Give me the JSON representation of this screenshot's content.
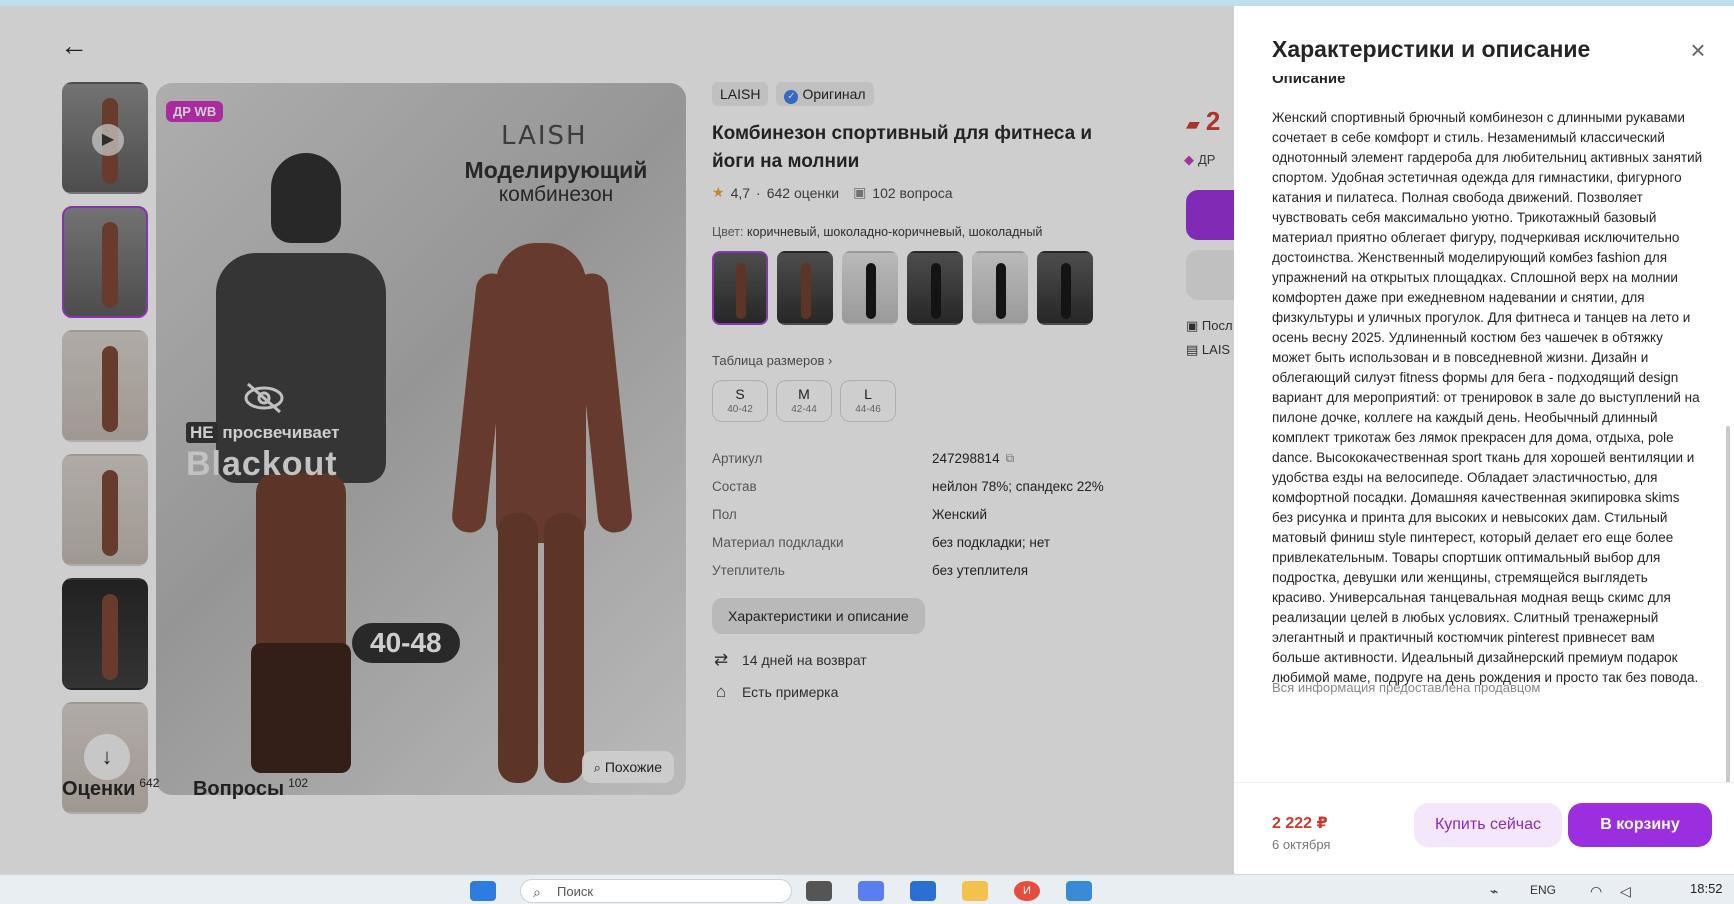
{
  "page": {
    "back_label": "←",
    "thumb_scroll_label": "↓",
    "play_label": "▶"
  },
  "photo": {
    "promo_badge": "ДР WB",
    "brand": "LAISH",
    "headline": "Моделирующий",
    "subheadline": "комбинезон",
    "ne_tag": "НЕ",
    "ne_rest": "просвечивает",
    "blackout": "Blackout",
    "size_range": "40-48",
    "similar_label": "Похожие"
  },
  "product": {
    "brand_badge": "LAISH",
    "original_badge": "Оригинал",
    "title": "Комбинезон спортивный для фитнеса и йоги на молнии",
    "rating": "4,7",
    "ratings_count": "642 оценки",
    "questions_count": "102 вопроса",
    "color_label": "Цвет:",
    "color_value": "коричневый, шоколадно-коричневый, шоколадный",
    "size_table_link": "Таблица размеров",
    "sizes": [
      {
        "size": "S",
        "range": "40-42"
      },
      {
        "size": "M",
        "range": "42-44"
      },
      {
        "size": "L",
        "range": "44-46"
      }
    ],
    "params": [
      {
        "key": "Артикул",
        "value": "247298814"
      },
      {
        "key": "Состав",
        "value": "нейлон 78%; спандекс 22%"
      },
      {
        "key": "Пол",
        "value": "Женский"
      },
      {
        "key": "Материал подкладки",
        "value": "без подкладки; нет"
      },
      {
        "key": "Утеплитель",
        "value": "без утеплителя"
      }
    ],
    "desc_button": "Характеристики и описание",
    "features": [
      {
        "icon": "return-icon",
        "text": "14 дней на возврат"
      },
      {
        "icon": "hanger-icon",
        "text": "Есть примерка"
      }
    ]
  },
  "price_card": {
    "price_partial": "2",
    "tag_partial": "ДР",
    "line1_partial": "Посл",
    "line2_partial": "LAIS"
  },
  "tabs": [
    {
      "label": "Оценки",
      "count": "642"
    },
    {
      "label": "Вопросы",
      "count": "102"
    }
  ],
  "drawer": {
    "title": "Характеристики и описание",
    "section_heading": "Описание",
    "description": "Женский спортивный брючный комбинезон с длинными рукавами сочетает в себе комфорт и стиль. Незаменимый классический однотонный элемент гардероба для любительниц активных занятий спортом. Удобная эстетичная одежда для гимнастики, фигурного катания и пилатеса. Полная свобода движений. Позволяет чувствовать себя максимально уютно. Трикотажный базовый материал приятно облегает фигуру, подчеркивая исключительно достоинства. Женственный моделирующий комбез fashion для упражнений на открытых площадках. Сплошной верх на молнии комфортен даже при ежедневном надевании и снятии, для физкультуры и уличных прогулок. Для фитнеса и танцев на лето и осень весну 2025. Удлиненный костюм без чашечек в обтяжку может быть использован и в повседневной жизни. Дизайн и облегающий силуэт fitness формы для бега - подходящий design вариант для мероприятий: от тренировок в зале до выступлений на пилоне дочке, коллеге на каждый день. Необычный длинный комплект трикотаж без лямок прекрасен для дома, отдыха, pole dance. Высококачественная sport ткань для хорошей вентиляции и удобства езды на велосипеде. Обладает эластичностью, для комфортной посадки. Домашняя качественная экипировка skims без рисунка и принта для высоких и невысоких дам. Стильный матовый финиш style пинтерест, который делает его еще более привлекательным. Товары спортшик оптимальный выбор для подростка, девушки или женщины, стремящейся выглядеть красиво. Универсальная танцевальная модная вещь скимс для реализации целей в любых условиях. Слитный тренажерный элегантный и практичный костюмчик pinterest привнесет вам больше активности. Идеальный дизайнерский премиум подарок любимой маме, подруге на день рождения и просто так без повода.",
    "disclaimer": "Вся информация предоставлена продавцом",
    "price": "2 222 ₽",
    "delivery": "6 октября",
    "buy_now": "Купить сейчас",
    "add_to_cart": "В корзину"
  },
  "taskbar": {
    "search_placeholder": "Поиск",
    "lang": "ENG",
    "time": "18:52",
    "chrome_badge": "И"
  },
  "colors": {
    "accent": "#9b2fe0",
    "price_red": "#d03a2b",
    "promo_pink": "#d02fc0"
  }
}
